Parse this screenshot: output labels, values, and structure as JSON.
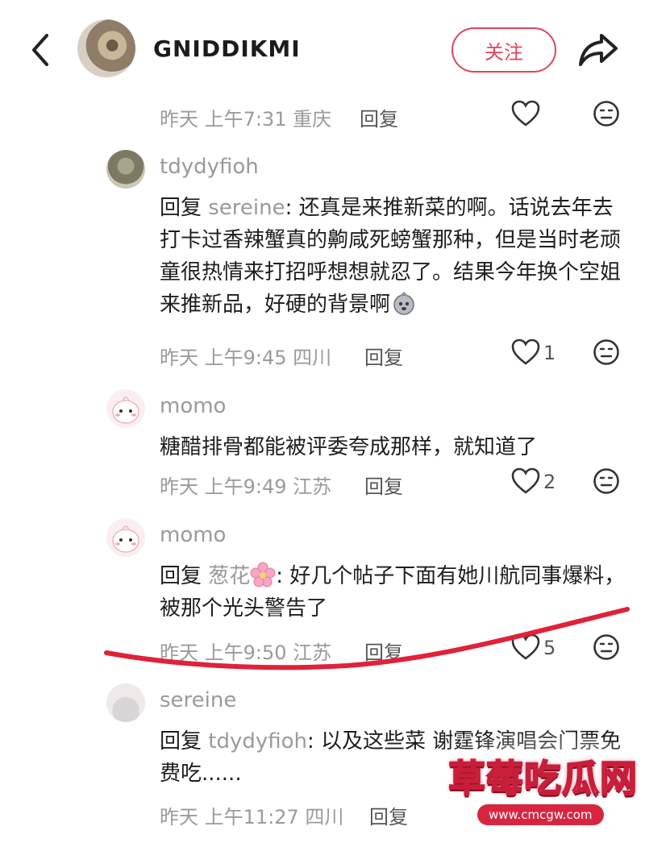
{
  "header": {
    "username": "GNIDDIKMI",
    "follow_label": "关注"
  },
  "comments": [
    {
      "meta": "昨天 上午7:31 重庆",
      "reply": "回复",
      "likes": ""
    },
    {
      "name": "tdydyfioh",
      "reply_prefix": "回复 ",
      "mention": "sereine",
      "text": ": 还真是来推新菜的啊。话说去年去打卡过香辣蟹真的齁咸死螃蟹那种，但是当时老顽童很热情来打招呼想想就忍了。结果今年换个空姐来推新品，好硬的背景啊",
      "meta": "昨天 上午9:45 四川",
      "reply": "回复",
      "likes": "1"
    },
    {
      "name": "momo",
      "text": "糖醋排骨都能被评委夸成那样，就知道了",
      "meta": "昨天 上午9:49 江苏",
      "reply": "回复",
      "likes": "2"
    },
    {
      "name": "momo",
      "reply_prefix": "回复 ",
      "mention": "葱花",
      "text": ": 好几个帖子下面有她川航同事爆料，被那个光头警告了",
      "meta": "昨天 上午9:50 江苏",
      "reply": "回复",
      "likes": "5"
    },
    {
      "name": "sereine",
      "reply_prefix": "回复 ",
      "mention": "tdydyfioh",
      "text": ": 以及这些菜 谢霆锋演唱会门票免费吃......",
      "meta": "昨天 上午11:27 四川",
      "reply": "回复",
      "likes": ""
    }
  ],
  "watermark": {
    "title": "草莓吃瓜网",
    "url": "www.cmcgw.com"
  },
  "colors": {
    "accent": "#e0455a",
    "meta_gray": "#9a9a9a",
    "annotation_red": "#e0213a"
  },
  "icons": [
    "back-arrow-icon",
    "share-icon",
    "heart-icon",
    "emoji-face-icon",
    "cherry-blossom-emoji",
    "money-bag-emoji"
  ]
}
